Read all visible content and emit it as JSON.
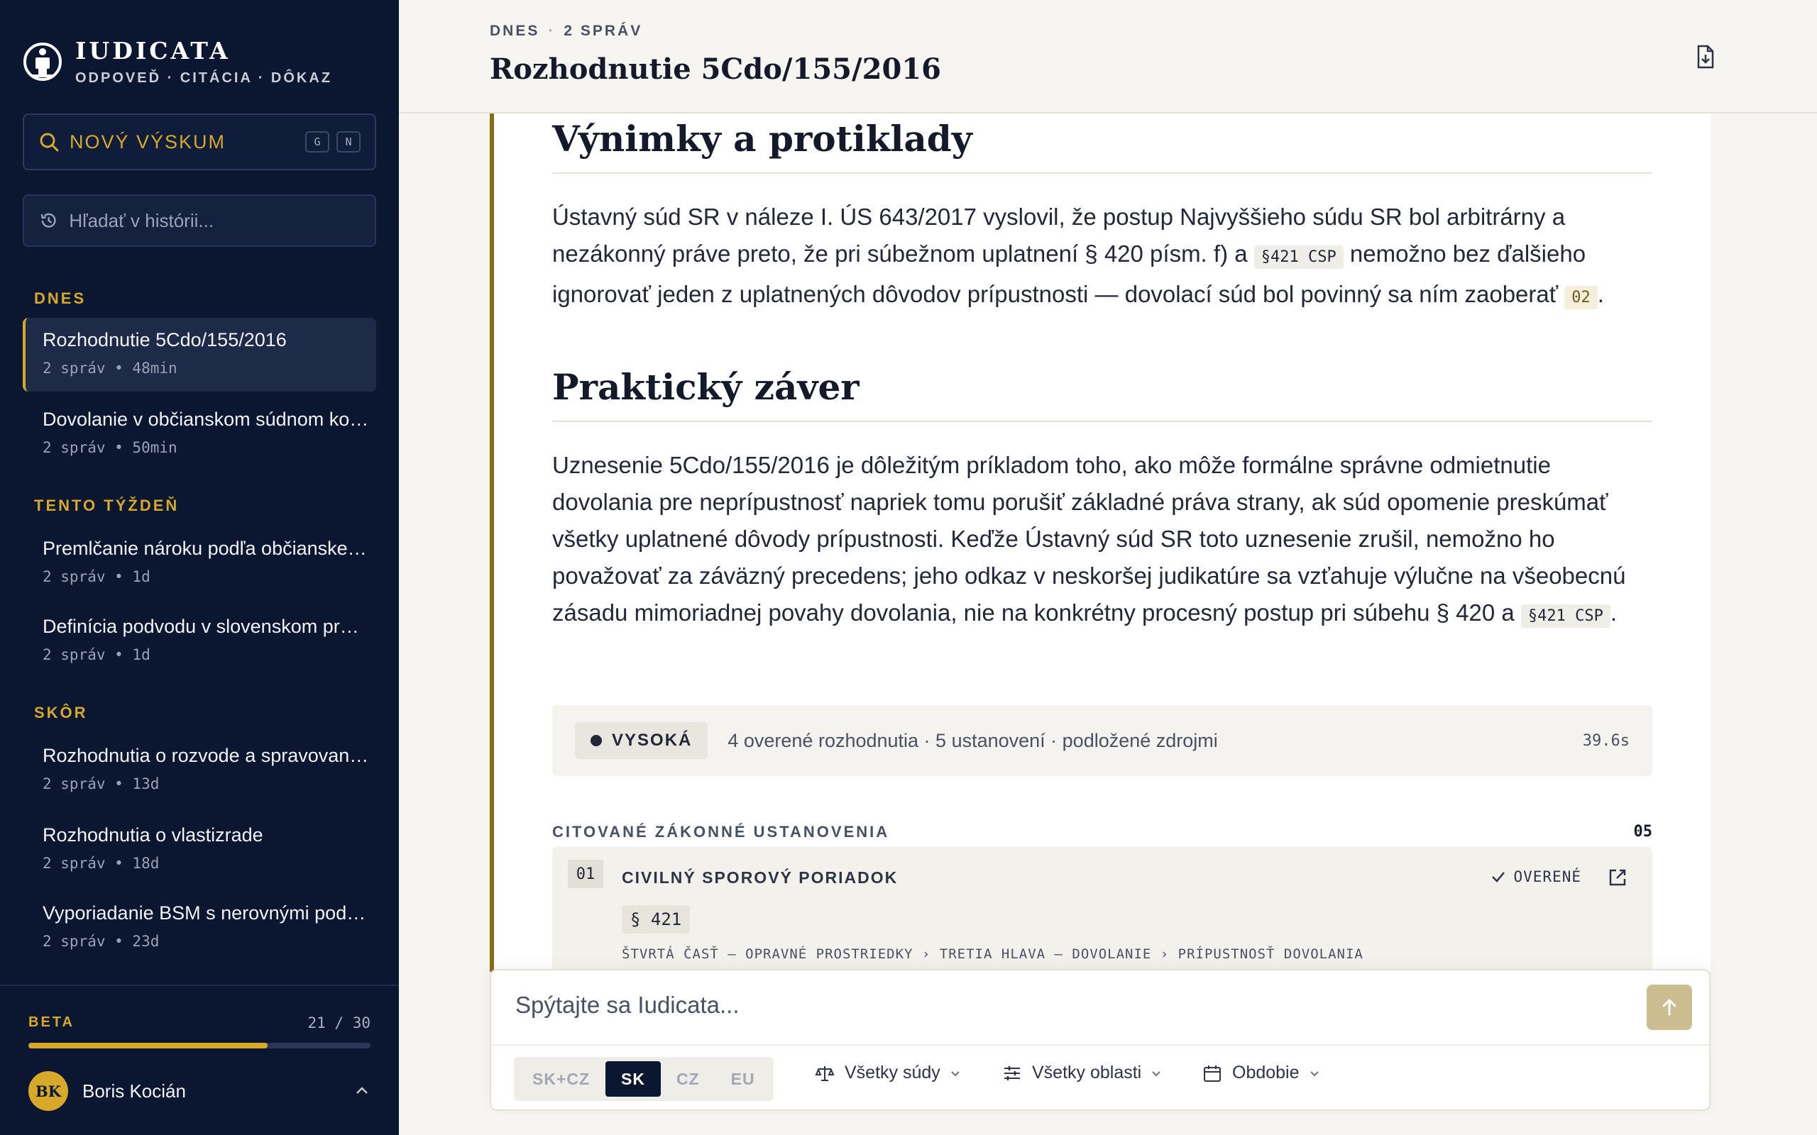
{
  "brand": {
    "name": "IUDICATA",
    "tagline": "ODPOVEĎ · CITÁCIA · DÔKAZ"
  },
  "sidebar": {
    "new_research_label": "NOVÝ VÝSKUM",
    "shortcut_keys": [
      "G",
      "N"
    ],
    "history_placeholder": "Hľadať v histórii...",
    "sections": [
      {
        "label": "DNES",
        "items": [
          {
            "title": "Rozhodnutie 5Cdo/155/2016",
            "meta": "2 správ • 48min",
            "active": true
          },
          {
            "title": "Dovolanie v občianskom súdnom konaní",
            "meta": "2 správ • 50min"
          }
        ]
      },
      {
        "label": "TENTO TÝŽDEŇ",
        "items": [
          {
            "title": "Premlčanie nároku podľa občianskeho zákonníka",
            "meta": "2 správ • 1d"
          },
          {
            "title": "Definícia podvodu v slovenskom práve",
            "meta": "2 správ • 1d"
          }
        ]
      },
      {
        "label": "SKÔR",
        "items": [
          {
            "title": "Rozhodnutia o rozvode a spravovaní majetku",
            "meta": "2 správ • 13d"
          },
          {
            "title": "Rozhodnutia o vlastizrade",
            "meta": "2 správ • 18d"
          },
          {
            "title": "Vyporiadanie BSM s nerovnými podielmi",
            "meta": "2 správ • 23d"
          }
        ]
      }
    ],
    "beta": {
      "label": "BETA",
      "count": "21 / 30",
      "used": 21,
      "total": 30
    },
    "user": {
      "initials": "BK",
      "name": "Boris Kocián"
    }
  },
  "header": {
    "crumb_day": "DNES",
    "crumb_count": "2 SPRÁV",
    "title": "Rozhodnutie 5Cdo/155/2016"
  },
  "content": {
    "section1": {
      "heading": "Výnimky a protiklady",
      "p1": "Ústavný súd SR v náleze I. ÚS 643/2017 vyslovil, že postup Najvyššieho súdu SR bol arbitrárny a nezákonný práve preto, že pri súbežnom uplatnení § 420 písm. f) a ",
      "code1": "§421 CSP",
      "p2": " nemožno bez ďalšieho ignorovať jeden z uplatnených dôvodov prípustnosti — dovolací súd bol povinný sa ním zaoberať ",
      "cite1": "02",
      "p3": "."
    },
    "section2": {
      "heading": "Praktický záver",
      "p1": "Uznesenie 5Cdo/155/2016 je dôležitým príkladom toho, ako môže formálne správne odmietnutie dovolania pre neprípustnosť napriek tomu porušiť základné práva strany, ak súd opomenie preskúmať všetky uplatnené dôvody prípustnosti. Keďže Ústavný súd SR toto uznesenie zrušil, nemožno ho považovať za záväzný precedens; jeho odkaz v neskoršej judikatúre sa vzťahuje výlučne na všeobecnú zásadu mimoriadnej povahy dovolania, nie na konkrétny procesný postup pri súbehu § 420 a ",
      "code1": "§421 CSP",
      "p2": "."
    },
    "confidence": {
      "label": "VYSOKÁ",
      "summary": "4 overené rozhodnutia · 5 ustanovení · podložené zdrojmi",
      "time": "39.6s"
    },
    "cited": {
      "title": "CITOVANÉ ZÁKONNÉ USTANOVENIA",
      "count": "05",
      "items": [
        {
          "num": "01",
          "name": "CIVILNÝ SPOROVÝ PORIADOK",
          "status": "OVERENÉ",
          "paragraph": "§ 421",
          "path": "ŠTVRTÁ ČASŤ — OPRAVNÉ PROSTRIEDKY › TRETIA HLAVA — DOVOLANIE › PRÍPUSTNOSŤ DOVOLANIA"
        }
      ]
    }
  },
  "composer": {
    "placeholder": "Spýtajte sa Iudicata...",
    "regions": [
      "SK+CZ",
      "SK",
      "CZ",
      "EU"
    ],
    "active_region": "SK",
    "filters": {
      "courts": "Všetky súdy",
      "areas": "Všetky oblasti",
      "period": "Obdobie"
    }
  },
  "colors": {
    "sidebar_bg": "#0b1630",
    "accent": "#d6a92b",
    "content_rule": "#8a6a14"
  }
}
